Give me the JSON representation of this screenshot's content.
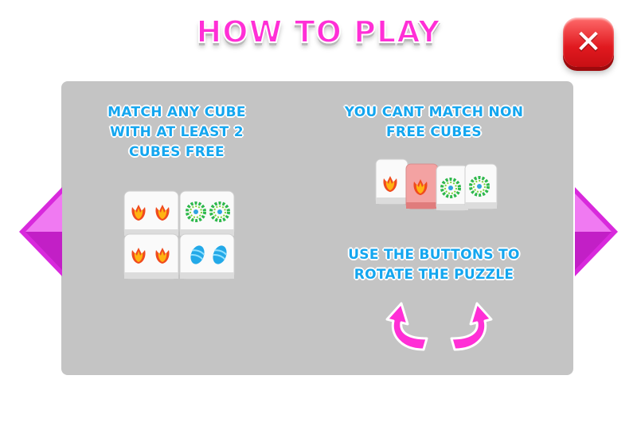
{
  "header": {
    "title": "HOW TO PLAY"
  },
  "close_button": {
    "icon": "close-icon",
    "color": "#e0191f"
  },
  "navigation": {
    "prev_icon": "triangle-left-icon",
    "next_icon": "triangle-right-icon",
    "color": "#e23ce6"
  },
  "instructions": {
    "match_rule": [
      "MATCH ANY CUBE",
      "WITH AT LEAST 2",
      "CUBES FREE"
    ],
    "non_free_rule": [
      "YOU CANT MATCH NON",
      "FREE CUBES"
    ],
    "rotate_rule": [
      "USE  THE BUTTONS TO",
      "ROTATE THE PUZZLE"
    ]
  },
  "example_cubes": {
    "grid_2x2": [
      "tulip",
      "wreath",
      "tulip",
      "easter-egg"
    ],
    "row": [
      "tulip",
      "tulip-highlighted",
      "wreath",
      "wreath"
    ]
  },
  "rotate_buttons": {
    "left_icon": "rotate-left-icon",
    "right_icon": "rotate-right-icon",
    "color": "#ff2fd6"
  },
  "colors": {
    "title": "#ff2fd6",
    "instruction_text": "#14a6ef",
    "panel": "#c4c4c4"
  }
}
